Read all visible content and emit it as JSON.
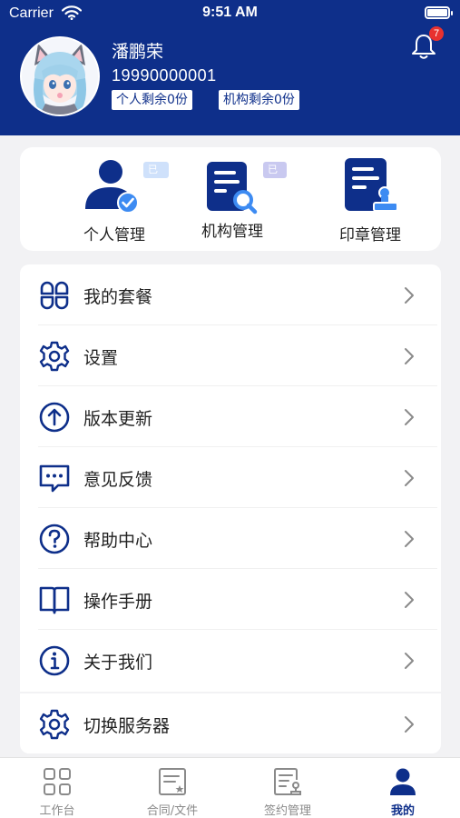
{
  "status_bar": {
    "carrier": "Carrier",
    "time": "9:51 AM"
  },
  "profile": {
    "name": "潘鹏荣",
    "phone": "19990000001",
    "personal_quota": "个人剩余0份",
    "org_quota": "机构剩余0份",
    "notification_count": "7"
  },
  "quick_actions": [
    {
      "label": "个人管理",
      "badge": "已认证",
      "icon": "person-verified-icon"
    },
    {
      "label": "机构管理",
      "badge": "已认证",
      "icon": "document-search-icon"
    },
    {
      "label": "印章管理",
      "icon": "document-stamp-icon"
    }
  ],
  "menu": [
    {
      "label": "我的套餐",
      "icon": "four-petal-icon"
    },
    {
      "label": "设置",
      "icon": "gear-icon"
    },
    {
      "label": "版本更新",
      "icon": "arrow-up-circle-icon"
    },
    {
      "label": "意见反馈",
      "icon": "chat-bubble-icon"
    },
    {
      "label": "帮助中心",
      "icon": "question-circle-icon"
    },
    {
      "label": "操作手册",
      "icon": "book-icon"
    },
    {
      "label": "关于我们",
      "icon": "info-circle-icon"
    },
    {
      "label": "切换服务器",
      "icon": "gear-icon"
    }
  ],
  "tabs": [
    {
      "label": "工作台",
      "icon": "grid-icon"
    },
    {
      "label": "合同/文件",
      "icon": "contract-icon"
    },
    {
      "label": "签约管理",
      "icon": "sign-manage-icon"
    },
    {
      "label": "我的",
      "icon": "person-icon",
      "active": true
    }
  ],
  "colors": {
    "brand": "#0e2f8a",
    "badge_red": "#e8312f",
    "accent_blue": "#3d8bf2"
  }
}
